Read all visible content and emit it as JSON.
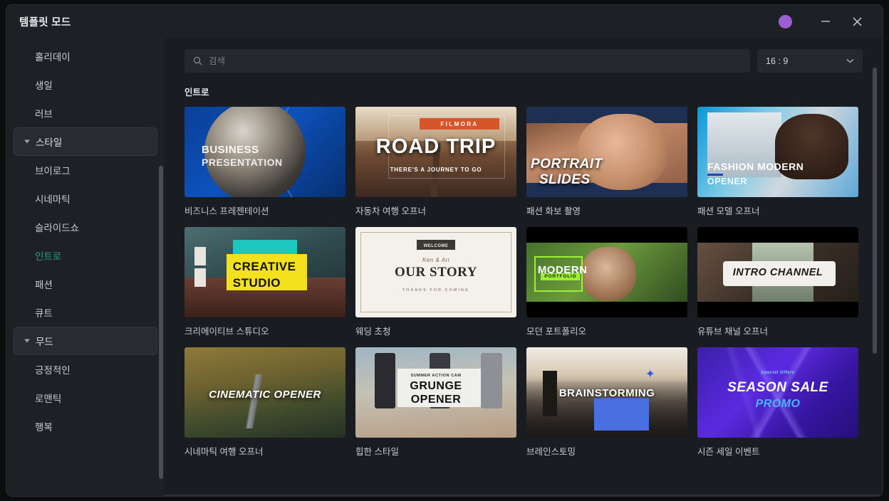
{
  "window": {
    "title": "템플릿 모드",
    "controls": {
      "avatar": "user-avatar",
      "minimize": "minimize",
      "close": "close"
    }
  },
  "sidebar": {
    "items": [
      {
        "label": "홀리데이",
        "type": "item",
        "state": "normal"
      },
      {
        "label": "생일",
        "type": "item",
        "state": "normal"
      },
      {
        "label": "러브",
        "type": "item",
        "state": "normal"
      },
      {
        "label": "스타일",
        "type": "group",
        "state": "expanded"
      },
      {
        "label": "브이로그",
        "type": "item",
        "state": "normal"
      },
      {
        "label": "시네마틱",
        "type": "item",
        "state": "normal"
      },
      {
        "label": "슬라이드쇼",
        "type": "item",
        "state": "normal"
      },
      {
        "label": "인트로",
        "type": "item",
        "state": "active"
      },
      {
        "label": "패션",
        "type": "item",
        "state": "normal"
      },
      {
        "label": "큐트",
        "type": "item",
        "state": "normal"
      },
      {
        "label": "무드",
        "type": "group",
        "state": "expanded"
      },
      {
        "label": "긍정적인",
        "type": "item",
        "state": "normal"
      },
      {
        "label": "로맨틱",
        "type": "item",
        "state": "normal"
      },
      {
        "label": "행복",
        "type": "item",
        "state": "normal"
      }
    ]
  },
  "toolbar": {
    "search": {
      "value": "",
      "placeholder": "검색",
      "icon": "search-icon"
    },
    "ratio": {
      "value": "16 : 9",
      "icon": "chevron-down-icon"
    }
  },
  "content": {
    "section_title": "인트로",
    "cards": [
      {
        "label": "비즈니스 프레젠테이션",
        "art": "business",
        "overlay1": "BUSINESS",
        "overlay2": "PRESENTATION"
      },
      {
        "label": "자동차 여행 오프너",
        "art": "roadtrip",
        "brand": "FILMORA",
        "overlay1": "ROAD TRIP",
        "overlay2": "THERE'S A JOURNEY TO GO"
      },
      {
        "label": "패션 화보 촬영",
        "art": "portrait",
        "overlay1": "PORTRAIT",
        "overlay2": "SLIDES"
      },
      {
        "label": "패션 모델 오프너",
        "art": "fashion",
        "overlay1": "FASHION MODERN",
        "overlay2": "OPENER"
      },
      {
        "label": "크리에이티브 스튜디오",
        "art": "creative",
        "overlay1": "CREATIVE",
        "overlay2": "STUDIO"
      },
      {
        "label": "웨딩 초청",
        "art": "wedding",
        "brand": "WELCOME",
        "overlay1": "OUR STORY",
        "overlay2": "THANKS FOR COMING"
      },
      {
        "label": "모던 포트폴리오",
        "art": "portfolio",
        "overlay1": "MODERN",
        "overlay2": "PORTFOLIO"
      },
      {
        "label": "유튜브 채널 오프너",
        "art": "intro",
        "overlay1": "INTRO CHANNEL",
        "overlay2": ""
      },
      {
        "label": "시네마틱 여행 오프너",
        "art": "cinematic",
        "overlay1": "CINEMATIC OPENER",
        "overlay2": ""
      },
      {
        "label": "힙한 스타일",
        "art": "grunge",
        "brand": "SUMMER ACTION CAM",
        "overlay1": "GRUNGE",
        "overlay2": "OPENER"
      },
      {
        "label": "브레인스토밍",
        "art": "brainstorm",
        "overlay1": "BRAINSTORMING",
        "overlay2": ""
      },
      {
        "label": "시즌 세일 이벤트",
        "art": "seasonsale",
        "brand": "Special Offers",
        "overlay1": "SEASON SALE",
        "overlay2": "PROMO"
      }
    ]
  },
  "colors": {
    "window_bg": "#1d2024",
    "content_bg": "#191c20",
    "accent_active": "#25a47a",
    "avatar_purple": "#9b5fd4",
    "input_bg": "#25282d"
  }
}
